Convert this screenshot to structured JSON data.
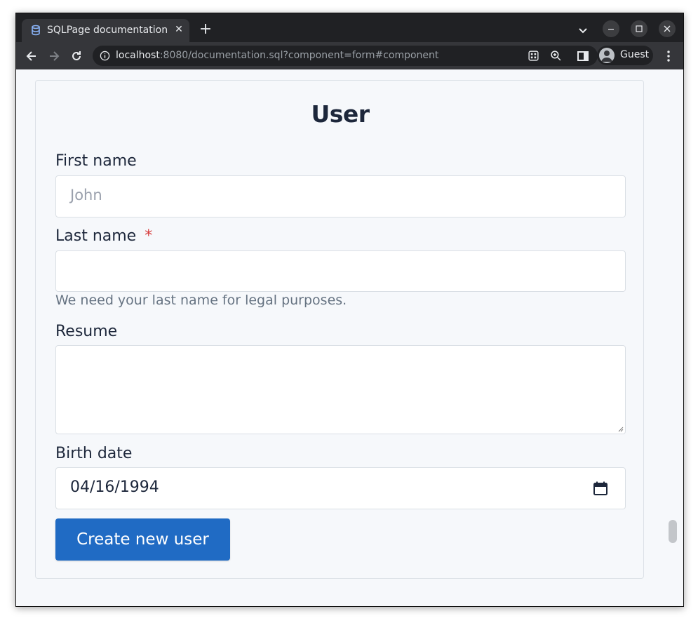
{
  "browser": {
    "tab_title": "SQLPage documentation",
    "tab_close": "✕",
    "new_tab": "+",
    "url_host": "localhost",
    "url_rest": ":8080/documentation.sql?component=form#component",
    "profile_label": "Guest"
  },
  "form": {
    "title": "User",
    "fields": [
      {
        "label": "First name",
        "placeholder": "John",
        "value": "",
        "required": false
      },
      {
        "label": "Last name",
        "required_mark": "*",
        "value": "",
        "description": "We need your last name for legal purposes."
      },
      {
        "label": "Resume",
        "value": "",
        "type": "textarea"
      },
      {
        "label": "Birth date",
        "value": "04/16/1994",
        "type": "date"
      }
    ],
    "submit_label": "Create new user"
  },
  "colors": {
    "primary": "#206bc4",
    "required": "#d63939",
    "text": "#1d273b",
    "muted": "#667382"
  }
}
